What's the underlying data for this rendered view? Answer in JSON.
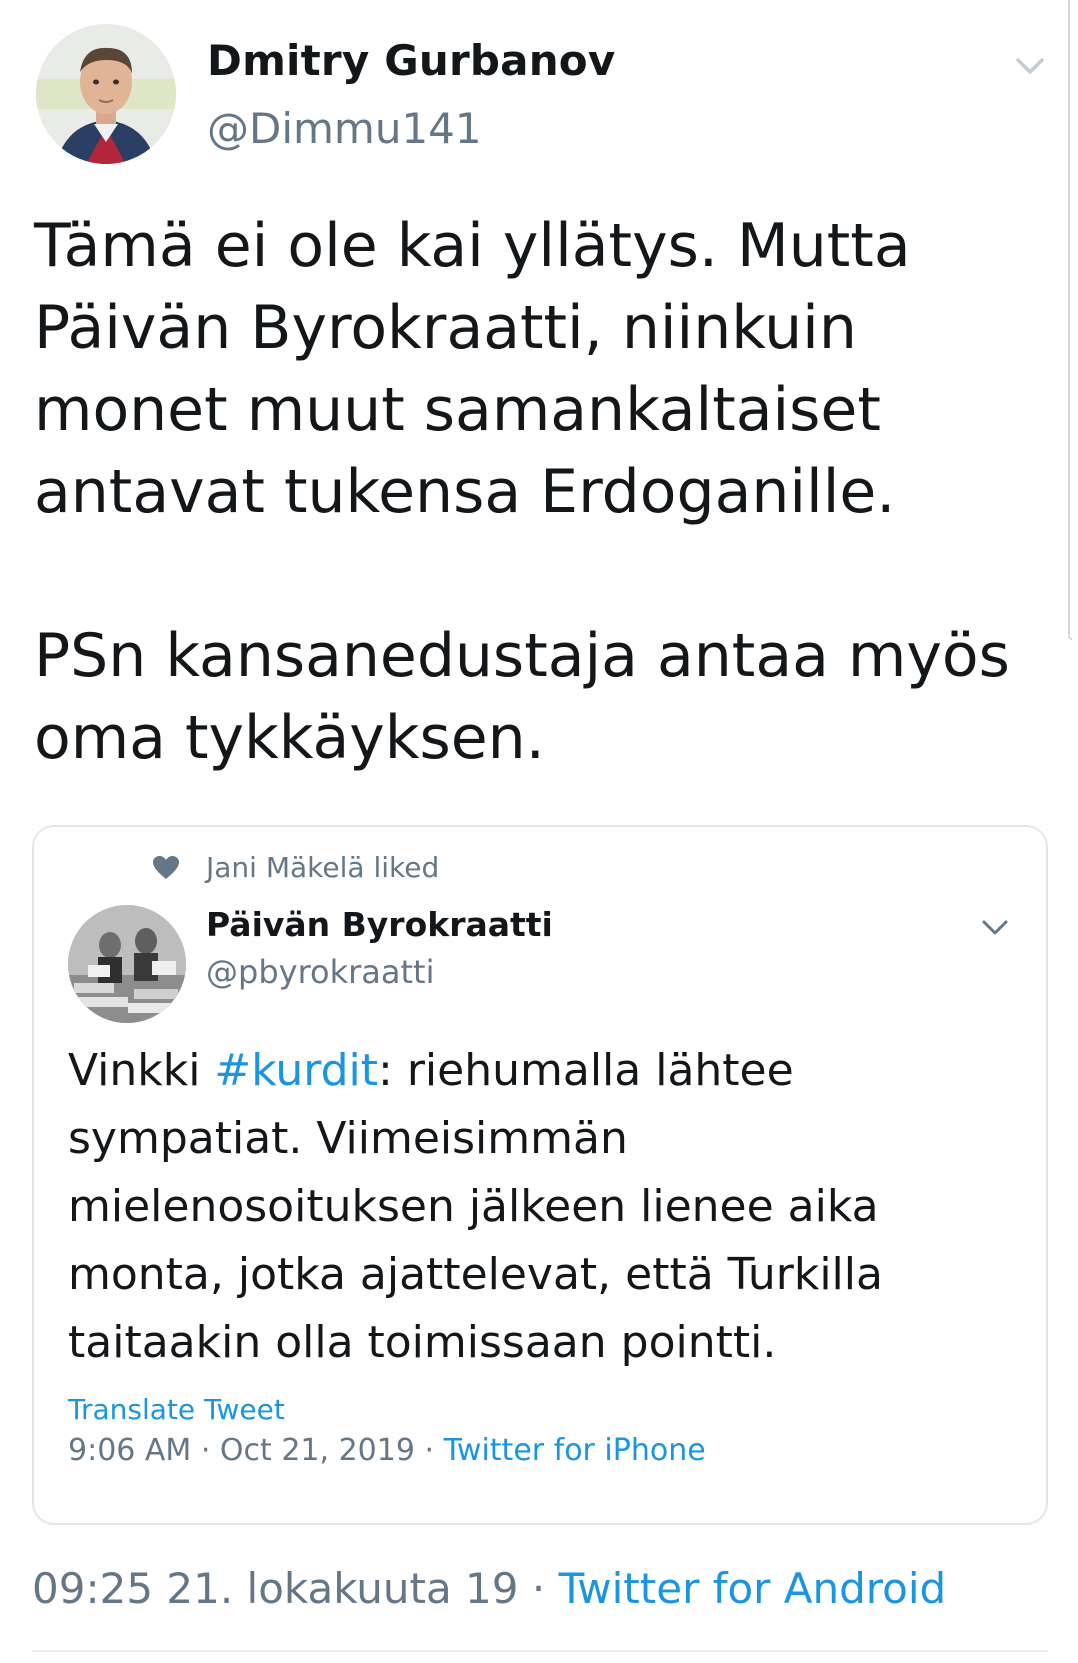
{
  "tweet": {
    "author": {
      "display_name": "Dmitry Gurbanov",
      "handle": "@Dimmu141",
      "avatar_icon": "user-avatar"
    },
    "text": "Tämä ei ole kai yllätys. Mutta\nPäivän Byrokraatti, niinkuin\nmonet muut samankaltaiset\nantavat tukensa Erdoganille.\n\nPSn kansanedustaja antaa myös\noma tykkäyksen.",
    "time": "09:25 21. lokakuuta 19",
    "separator": "·",
    "source": "Twitter for Android"
  },
  "quoted": {
    "liked_by": "Jani Mäkelä liked",
    "liked_icon": "heart-icon",
    "author": {
      "display_name": "Päivän Byrokraatti",
      "handle": "@pbyrokraatti"
    },
    "text_before": "Vinkki ",
    "hashtag": "#kurdit",
    "text_after": ": riehumalla lähtee sympatiat. Viimeisimmän mielenosoituksen jälkeen lienee aika monta, jotka ajattelevat, että Turkilla taitaakin olla toimissaan pointti.",
    "translate_label": "Translate Tweet",
    "time": "9:06 AM · Oct 21, 2019",
    "separator": "·",
    "source": "Twitter for iPhone"
  },
  "colors": {
    "text": "#14171a",
    "secondary": "#657786",
    "link": "#1b95e0",
    "border": "#e1e8ed"
  }
}
